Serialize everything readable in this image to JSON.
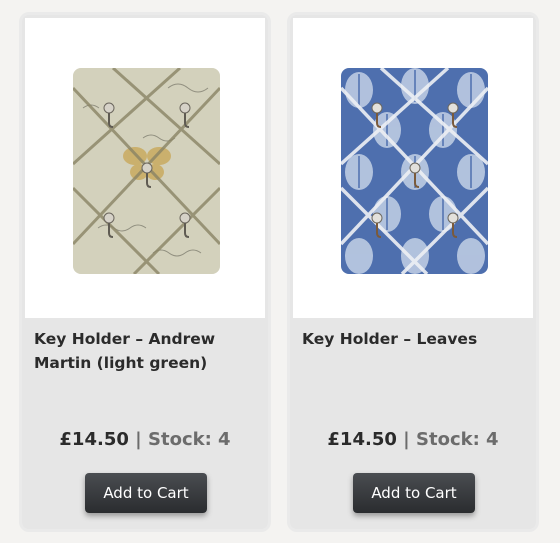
{
  "products": [
    {
      "title": "Key Holder – Andrew Martin (light green)",
      "price": "£14.50",
      "separator": "|",
      "stock": "Stock: 4",
      "button_label": "Add to Cart",
      "image_icon": "key-holder-andrew-martin-image",
      "board_color": "#d9d7c3"
    },
    {
      "title": "Key Holder – Leaves",
      "price": "£14.50",
      "separator": "|",
      "stock": "Stock: 4",
      "button_label": "Add to Cart",
      "image_icon": "key-holder-leaves-image",
      "board_color": "#4e6fae"
    }
  ]
}
